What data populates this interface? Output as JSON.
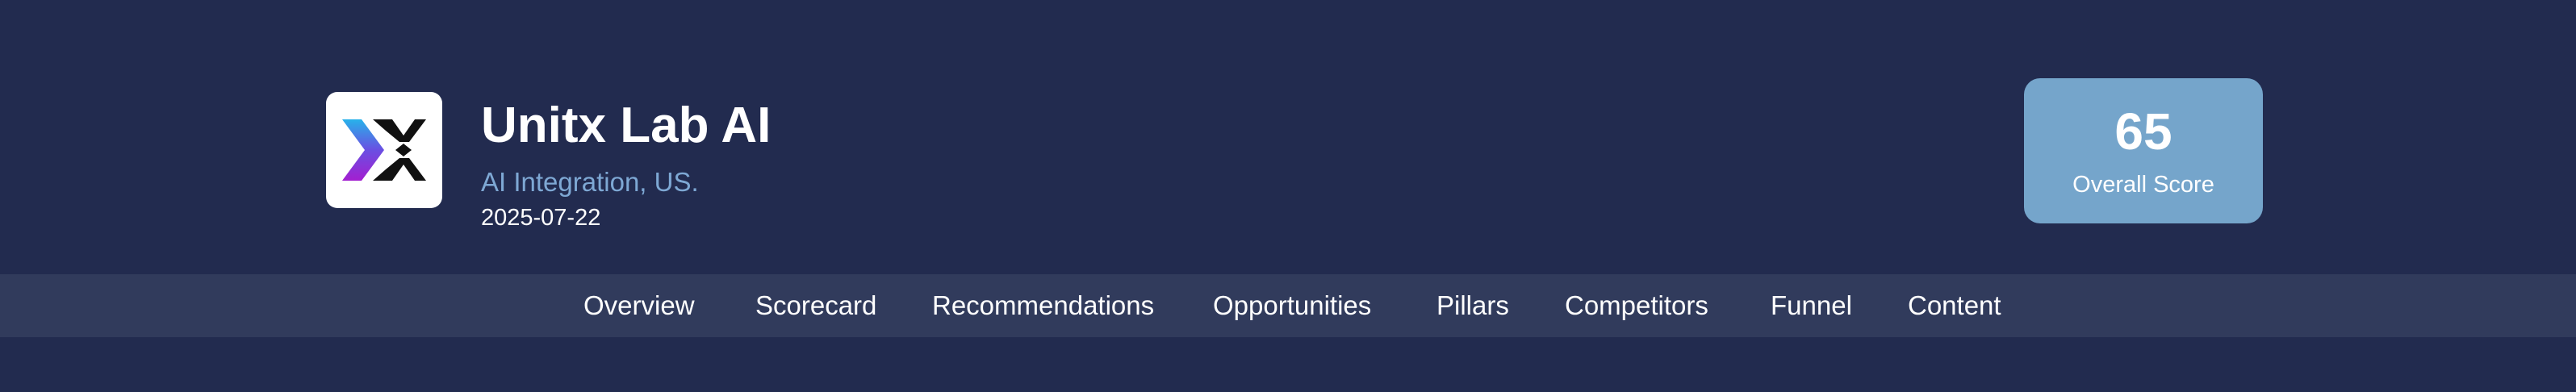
{
  "header": {
    "logo_icon": "unitx-logo-icon",
    "company_name": "Unitx Lab AI",
    "sector": "AI Integration, US.",
    "date": "2025-07-22"
  },
  "score": {
    "value": "65",
    "label": "Overall Score"
  },
  "nav": {
    "items": [
      {
        "label": "Overview"
      },
      {
        "label": "Scorecard"
      },
      {
        "label": "Recommendations"
      },
      {
        "label": "Opportunities"
      },
      {
        "label": "Pillars"
      },
      {
        "label": "Competitors"
      },
      {
        "label": "Funnel"
      },
      {
        "label": "Content"
      }
    ]
  },
  "colors": {
    "background": "#222b4f",
    "nav_background": "#313b5c",
    "accent_text": "#7ea8d4",
    "score_card": "#75a5cb"
  }
}
